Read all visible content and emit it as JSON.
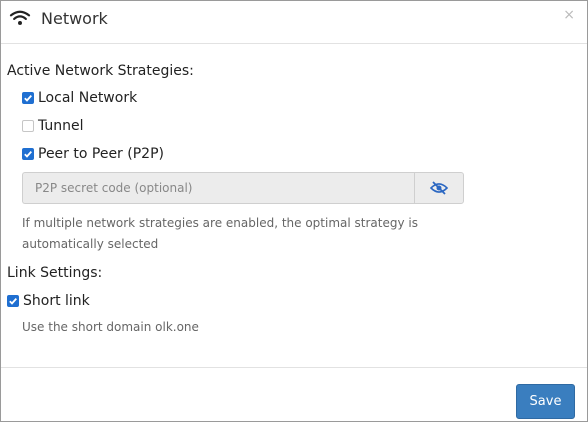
{
  "window": {
    "title": "Network",
    "close_symbol": "×"
  },
  "icons": {
    "header": "wifi-icon",
    "password_toggle": "eye-slash-icon",
    "checked": "checkmark-icon"
  },
  "colors": {
    "checkbox_checked": "#1f6fd1",
    "save_button": "#3a7ebf",
    "eye_icon": "#2b67c2"
  },
  "strategies": {
    "heading": "Active Network Strategies:",
    "local_network": {
      "label": "Local Network",
      "checked": true
    },
    "tunnel": {
      "label": "Tunnel",
      "checked": false
    },
    "p2p": {
      "label": "Peer to Peer (P2P)",
      "checked": true
    },
    "secret_placeholder": "P2P secret code (optional)",
    "help_line1": "If multiple network strategies are enabled, the optimal strategy is",
    "help_line2": "automatically selected"
  },
  "link_settings": {
    "heading": "Link Settings:",
    "short_link": {
      "label": "Short link",
      "checked": true
    },
    "description": "Use the short domain olk.one"
  },
  "footer": {
    "save_label": "Save"
  }
}
